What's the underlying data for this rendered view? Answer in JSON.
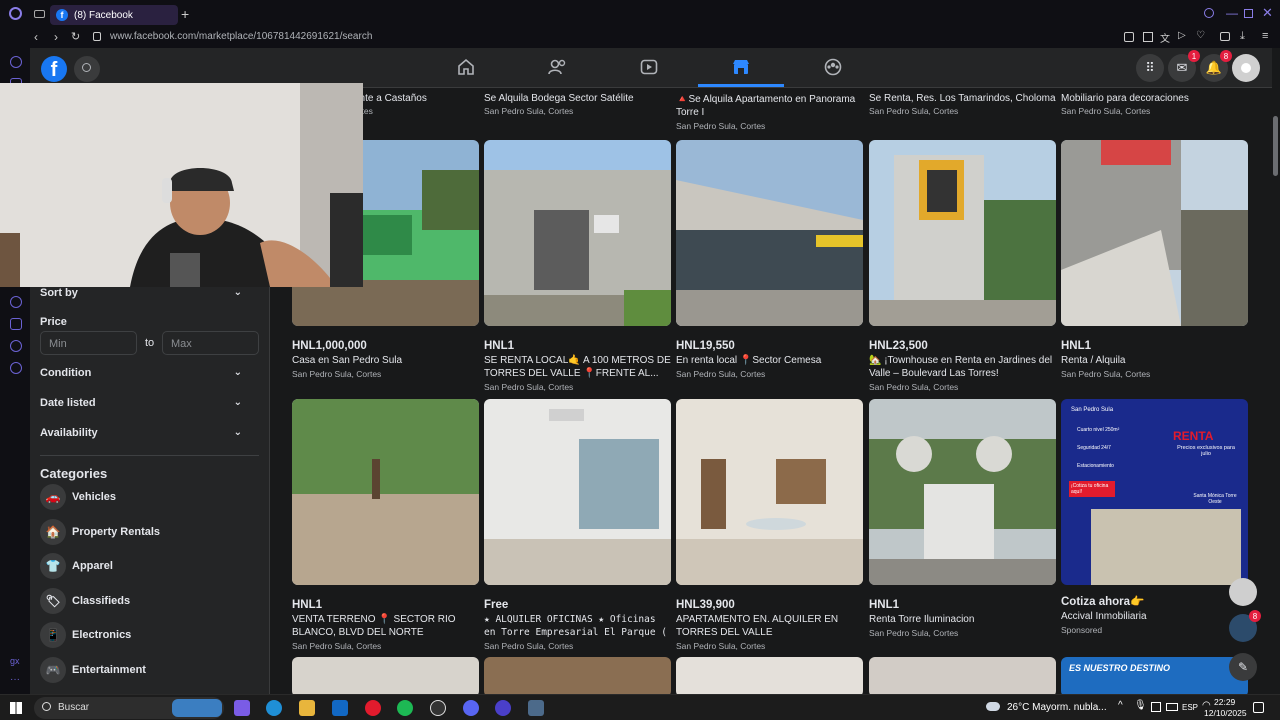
{
  "browser": {
    "tab_title": "(8) Facebook",
    "url": "www.facebook.com/marketplace/106781442691621/search"
  },
  "header": {
    "messenger_badge": "1",
    "notifications_badge": "8"
  },
  "sidebar": {
    "sort_by": "Sort by",
    "price_label": "Price",
    "min_placeholder": "Min",
    "to_label": "to",
    "max_placeholder": "Max",
    "condition": "Condition",
    "date_listed": "Date listed",
    "availability": "Availability",
    "categories_heading": "Categories",
    "categories": [
      "Vehicles",
      "Property Rentals",
      "Apparel",
      "Classifieds",
      "Electronics",
      "Entertainment"
    ]
  },
  "top_row": [
    {
      "title": "ente a Castaños",
      "location": "ortes"
    },
    {
      "title": "Se Alquila Bodega Sector Satélite",
      "location": "San Pedro Sula, Cortes"
    },
    {
      "title": "🔺Se Alquila Apartamento en Panorama Torre I",
      "location": "San Pedro Sula, Cortes"
    },
    {
      "title": "Se Renta, Res. Los Tamarindos, Choloma",
      "location": "San Pedro Sula, Cortes"
    },
    {
      "title": "Mobiliario para decoraciones",
      "location": "San Pedro Sula, Cortes"
    }
  ],
  "listings_row1": [
    {
      "price": "HNL1,000,000",
      "title": "Casa en San Pedro Sula",
      "location": "San Pedro Sula, Cortes"
    },
    {
      "price": "HNL1",
      "title": "SE RENTA LOCAL🤙 A 100 METROS DE TORRES DEL VALLE 📍FRENTE AL...",
      "location": "San Pedro Sula, Cortes"
    },
    {
      "price": "HNL19,550",
      "title": "En renta local 📍Sector Cemesa",
      "location": "San Pedro Sula, Cortes"
    },
    {
      "price": "HNL23,500",
      "title": "🏡 ¡Townhouse en Renta en Jardines del Valle – Boulevard Las Torres!",
      "location": "San Pedro Sula, Cortes"
    },
    {
      "price": "HNL1",
      "title": "Renta / Alquila",
      "location": "San Pedro Sula, Cortes"
    }
  ],
  "listings_row2": [
    {
      "price": "HNL1",
      "title": "VENTA TERRENO 📍 SECTOR RIO BLANCO, BLVD DEL NORTE",
      "location": "San Pedro Sula, Cortes"
    },
    {
      "price": "Free",
      "title": "★ ALQUILER OFICINAS ★ Oficinas en Torre Empresarial El Parque (",
      "location": "San Pedro Sula, Cortes"
    },
    {
      "price": "HNL39,900",
      "title": "APARTAMENTO EN. ALQUILER EN TORRES DEL VALLE",
      "location": "San Pedro Sula, Cortes"
    },
    {
      "price": "HNL1",
      "title": "Renta Torre Iluminacion",
      "location": "San Pedro Sula, Cortes"
    },
    {
      "price": "Cotiza ahora👉",
      "title": "Accival Inmobiliaria",
      "location": "Sponsored"
    }
  ],
  "ad": {
    "location": "San Pedro Sula",
    "headline": "RENTA",
    "sub": "Precios exclusivos para julio",
    "bullets": [
      "Cuarto nivel 250m²",
      "Seguridad 24/7",
      "Estacionamiento"
    ],
    "cta": "¡Cotiza tu oficina aquí!",
    "tower": "Santa Mónica Torre Oeste"
  },
  "bottom_ad_text": "ES NUESTRO DESTINO",
  "chat_badge": "8",
  "taskbar": {
    "search": "Buscar",
    "weather": "26°C  Mayorm. nubla...",
    "lang": "ESP",
    "time": "22:29",
    "date": "12/10/2025"
  }
}
